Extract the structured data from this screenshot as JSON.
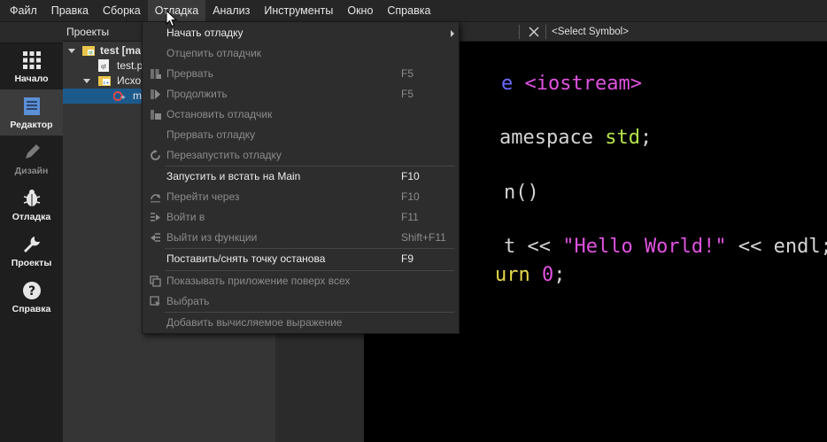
{
  "menubar": {
    "items": [
      "Файл",
      "Правка",
      "Сборка",
      "Отладка",
      "Анализ",
      "Инструменты",
      "Окно",
      "Справка"
    ]
  },
  "modes": [
    {
      "label": "Начало",
      "icon": "grid-icon"
    },
    {
      "label": "Редактор",
      "icon": "document-icon"
    },
    {
      "label": "Дизайн",
      "icon": "pencil-icon"
    },
    {
      "label": "Отладка",
      "icon": "bug-icon"
    },
    {
      "label": "Проекты",
      "icon": "wrench-icon"
    },
    {
      "label": "Справка",
      "icon": "help-icon"
    }
  ],
  "projects": {
    "header": "Проекты",
    "tree": [
      {
        "label": "test [ma"
      },
      {
        "label": "test.p"
      },
      {
        "label": "Исхо"
      },
      {
        "label": "m"
      }
    ]
  },
  "editor": {
    "symbol_selector": "<Select Symbol>",
    "lines": [
      {
        "parts": [
          {
            "t": "e ",
            "c": "#6b6bff"
          },
          {
            "t": "<iostream>",
            "c": "#e052e0"
          }
        ]
      },
      {
        "parts": [
          {
            "t": "amespace ",
            "c": "#d4d4d4"
          },
          {
            "t": "std",
            "c": "#b5e34a"
          },
          {
            "t": ";",
            "c": "#d4d4d4"
          }
        ]
      },
      {
        "parts": [
          {
            "t": "n()",
            "c": "#d4d4d4"
          }
        ]
      },
      {
        "parts": [
          {
            "t": "t << ",
            "c": "#d4d4d4"
          },
          {
            "t": "\"Hello World!\"",
            "c": "#e052e0"
          },
          {
            "t": " << endl;",
            "c": "#d4d4d4"
          }
        ]
      },
      {
        "parts": [
          {
            "t": "urn ",
            "c": "#e6d84a"
          },
          {
            "t": "0",
            "c": "#e052e0"
          },
          {
            "t": ";",
            "c": "#d4d4d4"
          }
        ]
      }
    ]
  },
  "debug_menu": {
    "items": [
      {
        "label": "Начать отладку",
        "shortcut": "",
        "enabled": true,
        "submenu": true,
        "icon": ""
      },
      {
        "label": "Отцепить отладчик",
        "shortcut": "",
        "enabled": false,
        "icon": ""
      },
      {
        "label": "Прервать",
        "shortcut": "F5",
        "enabled": false,
        "icon": "interrupt-icon"
      },
      {
        "label": "Продолжить",
        "shortcut": "F5",
        "enabled": false,
        "icon": "continue-icon"
      },
      {
        "label": "Остановить отладчик",
        "shortcut": "",
        "enabled": false,
        "icon": "stop-debugger-icon"
      },
      {
        "label": "Прервать отладку",
        "shortcut": "",
        "enabled": false,
        "icon": ""
      },
      {
        "label": "Перезапустить отладку",
        "shortcut": "",
        "enabled": false,
        "icon": "restart-icon"
      },
      {
        "label": "Запустить и встать на Main",
        "shortcut": "F10",
        "enabled": true,
        "icon": ""
      },
      {
        "label": "Перейти через",
        "shortcut": "F10",
        "enabled": false,
        "icon": "step-over-icon"
      },
      {
        "label": "Войти в",
        "shortcut": "F11",
        "enabled": false,
        "icon": "step-into-icon"
      },
      {
        "label": "Выйти из функции",
        "shortcut": "Shift+F11",
        "enabled": false,
        "icon": "step-out-icon"
      },
      {
        "label": "Поставить/снять точку останова",
        "shortcut": "F9",
        "enabled": true,
        "icon": ""
      },
      {
        "label": "Показывать приложение поверх всех",
        "shortcut": "",
        "enabled": false,
        "icon": "app-on-top-icon"
      },
      {
        "label": "Выбрать",
        "shortcut": "",
        "enabled": false,
        "icon": "select-icon"
      },
      {
        "label": "Добавить вычисляемое выражение",
        "shortcut": "",
        "enabled": false,
        "icon": ""
      }
    ]
  },
  "colors": {
    "accent_selection": "#1d5a8c",
    "menu_bg": "#2d2d2d"
  }
}
